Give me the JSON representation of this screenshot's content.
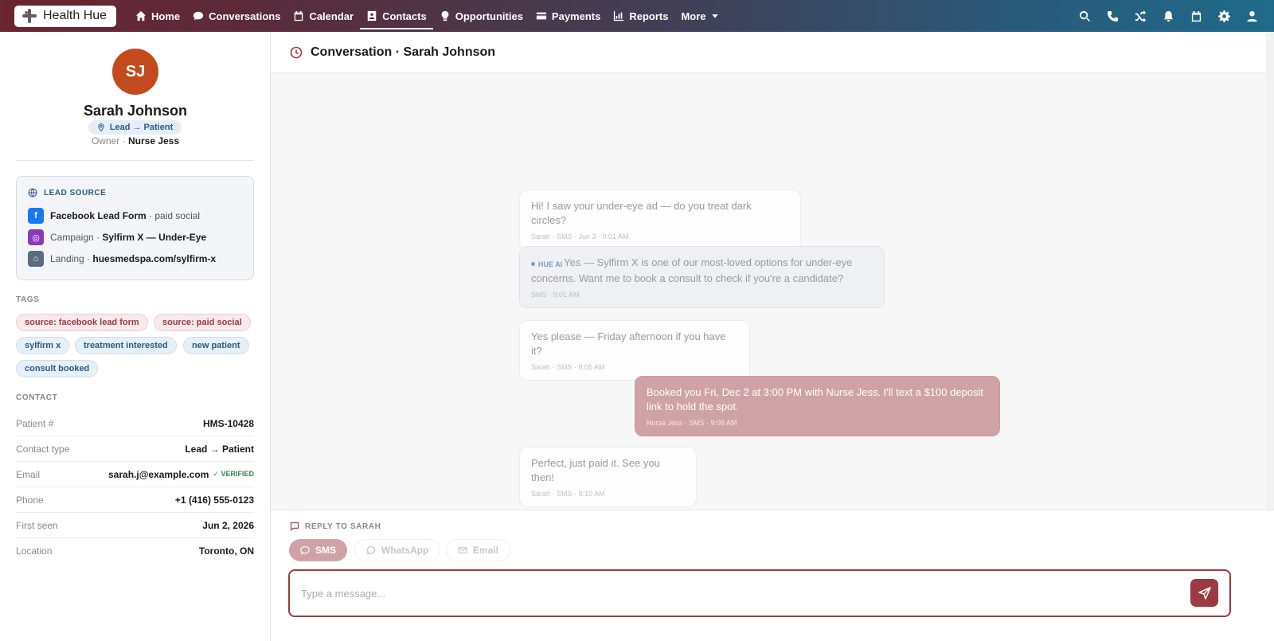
{
  "app": {
    "logo_text": "Health Hue"
  },
  "nav": {
    "items": [
      {
        "label": "Home",
        "icon": "home-icon"
      },
      {
        "label": "Conversations",
        "icon": "chat-bubble-icon"
      },
      {
        "label": "Calendar",
        "icon": "calendar-icon"
      },
      {
        "label": "Contacts",
        "icon": "contact-card-icon",
        "active": true
      },
      {
        "label": "Opportunities",
        "icon": "lightbulb-icon"
      },
      {
        "label": "Payments",
        "icon": "credit-card-icon"
      },
      {
        "label": "Reports",
        "icon": "bar-chart-icon"
      },
      {
        "label": "More",
        "icon": "caret-down-icon"
      }
    ],
    "right_icons": [
      "search-icon",
      "phone-icon",
      "shuffle-icon",
      "bell-icon",
      "calendar-icon",
      "gear-icon",
      "user-icon"
    ]
  },
  "contact": {
    "initials": "SJ",
    "name": "Sarah Johnson",
    "stage": "Lead → Patient",
    "owner_label": "Owner ·",
    "owner": "Nurse Jess"
  },
  "lead_source": {
    "title": "LEAD SOURCE",
    "rows": [
      {
        "icon": "facebook-icon",
        "icon_char": "f",
        "color": "#1877f2",
        "bold": "Facebook Lead Form",
        "suffix": " · paid social",
        "prefix": ""
      },
      {
        "icon": "instagram-icon",
        "icon_char": "◎",
        "color": "#8a3ab9",
        "prefix": "Campaign · ",
        "bold": "Sylfirm X — Under-Eye",
        "suffix": ""
      },
      {
        "icon": "landing-page-icon",
        "icon_char": "⌂",
        "color": "#5b6b80",
        "prefix": "Landing · ",
        "bold": "huesmedspa.com/sylfirm-x",
        "suffix": ""
      }
    ]
  },
  "tags": {
    "title": "TAGS",
    "items": [
      {
        "label": "source: facebook lead form",
        "tone": "red"
      },
      {
        "label": "source: paid social",
        "tone": "red"
      },
      {
        "label": "sylfirm x",
        "tone": "blue"
      },
      {
        "label": "treatment interested",
        "tone": "blue"
      },
      {
        "label": "new patient",
        "tone": "blue"
      },
      {
        "label": "consult booked",
        "tone": "blue"
      }
    ]
  },
  "contact_info": {
    "title": "CONTACT",
    "rows": [
      {
        "key": "Patient #",
        "value": "HMS-10428"
      },
      {
        "key": "Contact type",
        "value": "Lead → Patient"
      },
      {
        "key": "Email",
        "value": "sarah.j@example.com",
        "badge": "✓ VERIFIED"
      },
      {
        "key": "Phone",
        "value": "+1 (416) 555-0123"
      },
      {
        "key": "First seen",
        "value": "Jun 2, 2026"
      },
      {
        "key": "Location",
        "value": "Toronto, ON"
      }
    ]
  },
  "conversation": {
    "title": "Conversation · Sarah Johnson",
    "messages": [
      {
        "kind": "in",
        "text": "Hi! I saw your under-eye ad — do you treat dark circles?",
        "meta": "Sarah · SMS · Jun 3 · 9:01 AM"
      },
      {
        "kind": "ai",
        "ai_label": "HUE AI",
        "text": "Yes — Sylfirm X is one of our most-loved options for under-eye concerns. Want me to book a consult to check if you're a candidate?",
        "meta": "SMS · 9:01 AM"
      },
      {
        "kind": "in",
        "text": "Yes please — Friday afternoon if you have it?",
        "meta": "Sarah · SMS · 9:05 AM"
      },
      {
        "kind": "out",
        "text": "Booked you Fri, Dec 2 at 3:00 PM with Nurse Jess. I'll text a $100 deposit link to hold the spot.",
        "meta": "Nurse Jess · SMS · 9:08 AM"
      },
      {
        "kind": "in",
        "text": "Perfect, just paid it. See you then!",
        "meta": "Sarah · SMS · 9:10 AM"
      }
    ]
  },
  "composer": {
    "reply_label": "REPLY TO SARAH",
    "channels": [
      {
        "label": "SMS",
        "active": true
      },
      {
        "label": "WhatsApp",
        "active": false
      },
      {
        "label": "Email",
        "active": false
      }
    ],
    "placeholder": "Type a message..."
  },
  "colors": {
    "accent": "#9b3a42",
    "avatar": "#c24a1c",
    "link_blue": "#2a5a86"
  }
}
